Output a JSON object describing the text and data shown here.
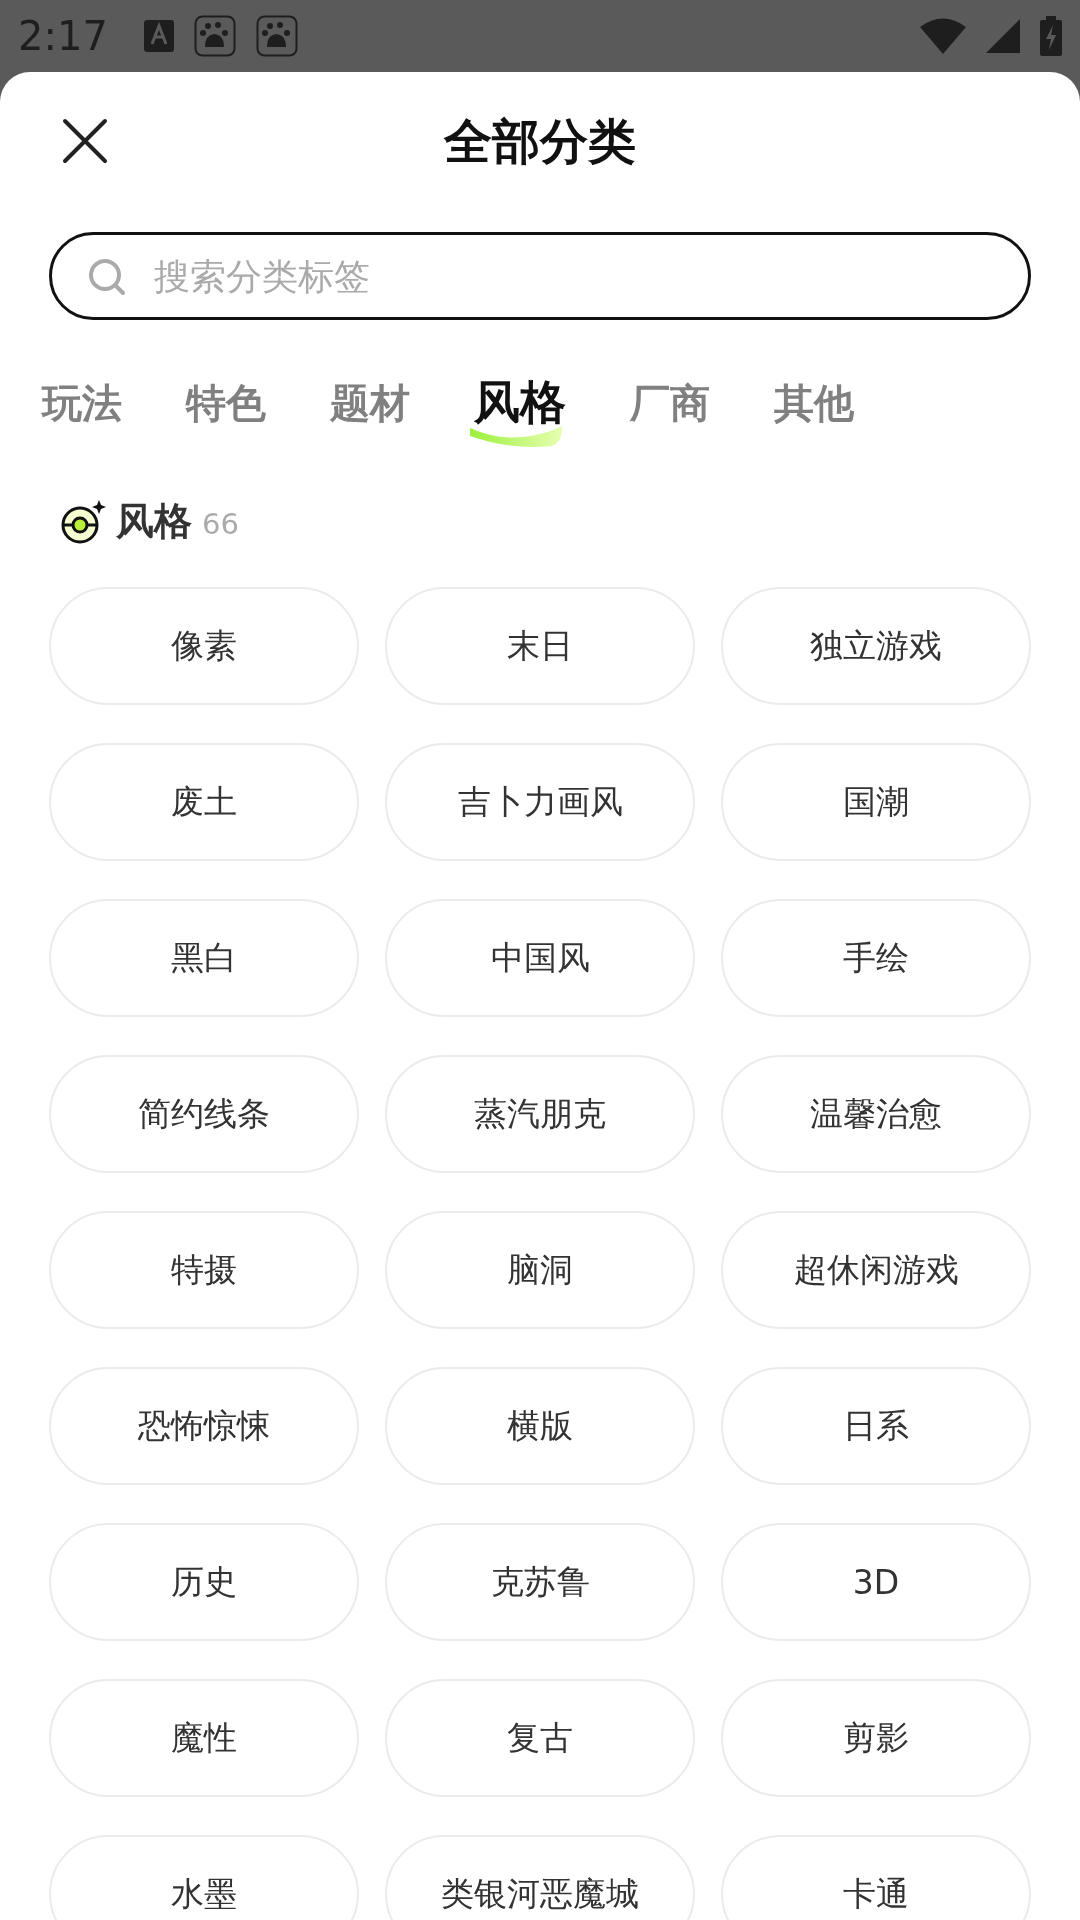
{
  "status_bar": {
    "time": "2:17"
  },
  "header": {
    "title": "全部分类"
  },
  "search": {
    "placeholder": "搜索分类标签"
  },
  "tabs": [
    {
      "label": "玩法",
      "selected": false
    },
    {
      "label": "特色",
      "selected": false
    },
    {
      "label": "题材",
      "selected": false
    },
    {
      "label": "风格",
      "selected": true
    },
    {
      "label": "厂商",
      "selected": false
    },
    {
      "label": "其他",
      "selected": false
    }
  ],
  "section": {
    "title": "风格",
    "count": "66"
  },
  "tags": [
    "像素",
    "末日",
    "独立游戏",
    "废土",
    "吉卜力画风",
    "国潮",
    "黑白",
    "中国风",
    "手绘",
    "简约线条",
    "蒸汽朋克",
    "温馨治愈",
    "特摄",
    "脑洞",
    "超休闲游戏",
    "恐怖惊悚",
    "横版",
    "日系",
    "历史",
    "克苏鲁",
    "3D",
    "魔性",
    "复古",
    "剪影",
    "水墨",
    "类银河恶魔城",
    "卡通"
  ]
}
